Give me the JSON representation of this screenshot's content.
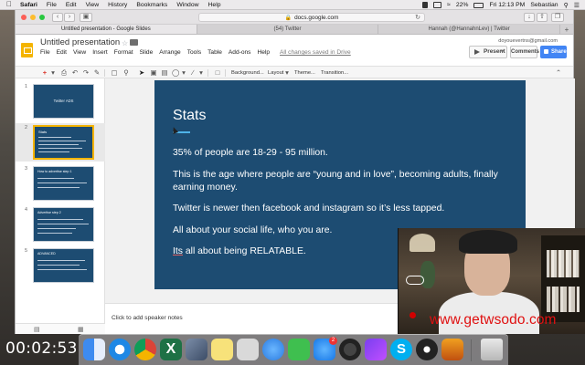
{
  "menubar": {
    "app": "Safari",
    "items": [
      "File",
      "Edit",
      "View",
      "History",
      "Bookmarks",
      "Window",
      "Help"
    ],
    "battery": "22%",
    "clock": "Fri 12:13 PM",
    "user": "Sebastian"
  },
  "browser": {
    "url": "docs.google.com",
    "tabs": [
      "Untitled presentation - Google Slides",
      "(54) Twitter",
      "Hannah (@HannahnLev) | Twitter"
    ]
  },
  "slides_app": {
    "doc_title": "Untitled presentation",
    "menus": [
      "File",
      "Edit",
      "View",
      "Insert",
      "Format",
      "Slide",
      "Arrange",
      "Tools",
      "Table",
      "Add-ons",
      "Help"
    ],
    "save_status": "All changes saved in Drive",
    "account": "doyouevertns@gmail.com",
    "present_label": "Present",
    "comments_label": "Comments",
    "share_label": "Share",
    "toolbar_labels": {
      "background": "Background...",
      "layout": "Layout",
      "theme": "Theme...",
      "transition": "Transition..."
    }
  },
  "filmstrip": {
    "slides": [
      {
        "num": "1",
        "title": "Twitter ADS"
      },
      {
        "num": "2",
        "title": "Stats"
      },
      {
        "num": "3",
        "title": "How to advertise step 1"
      },
      {
        "num": "4",
        "title": "Advertise step 2"
      },
      {
        "num": "5",
        "title": "ADVANCED"
      }
    ],
    "selected": 1
  },
  "current_slide": {
    "title": "Stats",
    "bullets": [
      "35% of people are 18-29 - 95 million.",
      "This is the age where people are “young and in love”, becoming adults, finally earning money.",
      "Twitter is newer then facebook and instagram so it’s less tapped.",
      "All about your social life, who you are."
    ],
    "last_word_underlined": "Its",
    "last_rest": " all about being RELATABLE."
  },
  "notes": {
    "placeholder": "Click to add speaker notes"
  },
  "overlay": {
    "watermark": "www.getwsodo.com",
    "timecode": "00:02:53"
  },
  "dock": {
    "app_store_badge": "2"
  },
  "colors": {
    "slide_bg": "#1d4c72",
    "accent_rule": "#4fb3e8",
    "share_blue": "#4285f4",
    "slides_yellow": "#f4b400",
    "watermark_red": "#e01010"
  }
}
